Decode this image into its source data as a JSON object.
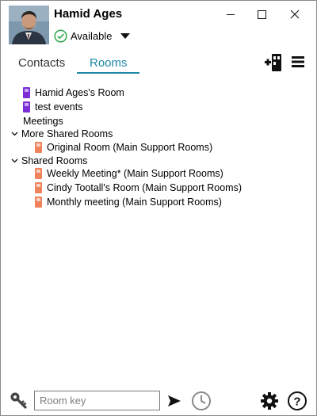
{
  "user": {
    "name": "Hamid Ages",
    "status": "Available"
  },
  "window": {
    "minimize_icon": "minimize-icon",
    "maximize_icon": "maximize-icon",
    "close_icon": "close-icon"
  },
  "tabs": [
    {
      "label": "Contacts",
      "active": false
    },
    {
      "label": "Rooms",
      "active": true
    }
  ],
  "accent": "#1e87a8",
  "room_colors": {
    "own": "#7b2fd4",
    "shared": "#f0825c"
  },
  "tree": {
    "my_rooms": [
      {
        "label": "Hamid Ages's Room"
      },
      {
        "label": "test events"
      }
    ],
    "meetings_label": "Meetings",
    "groups": [
      {
        "label": "More Shared Rooms",
        "expanded": true,
        "items": [
          {
            "label": "Original Room (Main Support Rooms)"
          }
        ]
      },
      {
        "label": "Shared Rooms",
        "expanded": true,
        "items": [
          {
            "label": "Weekly Meeting* (Main Support Rooms)"
          },
          {
            "label": "Cindy Tootall's Room (Main Support Rooms)"
          },
          {
            "label": "Monthly meeting (Main Support Rooms)"
          }
        ]
      }
    ]
  },
  "footer": {
    "room_key_placeholder": "Room key",
    "room_key_value": ""
  }
}
